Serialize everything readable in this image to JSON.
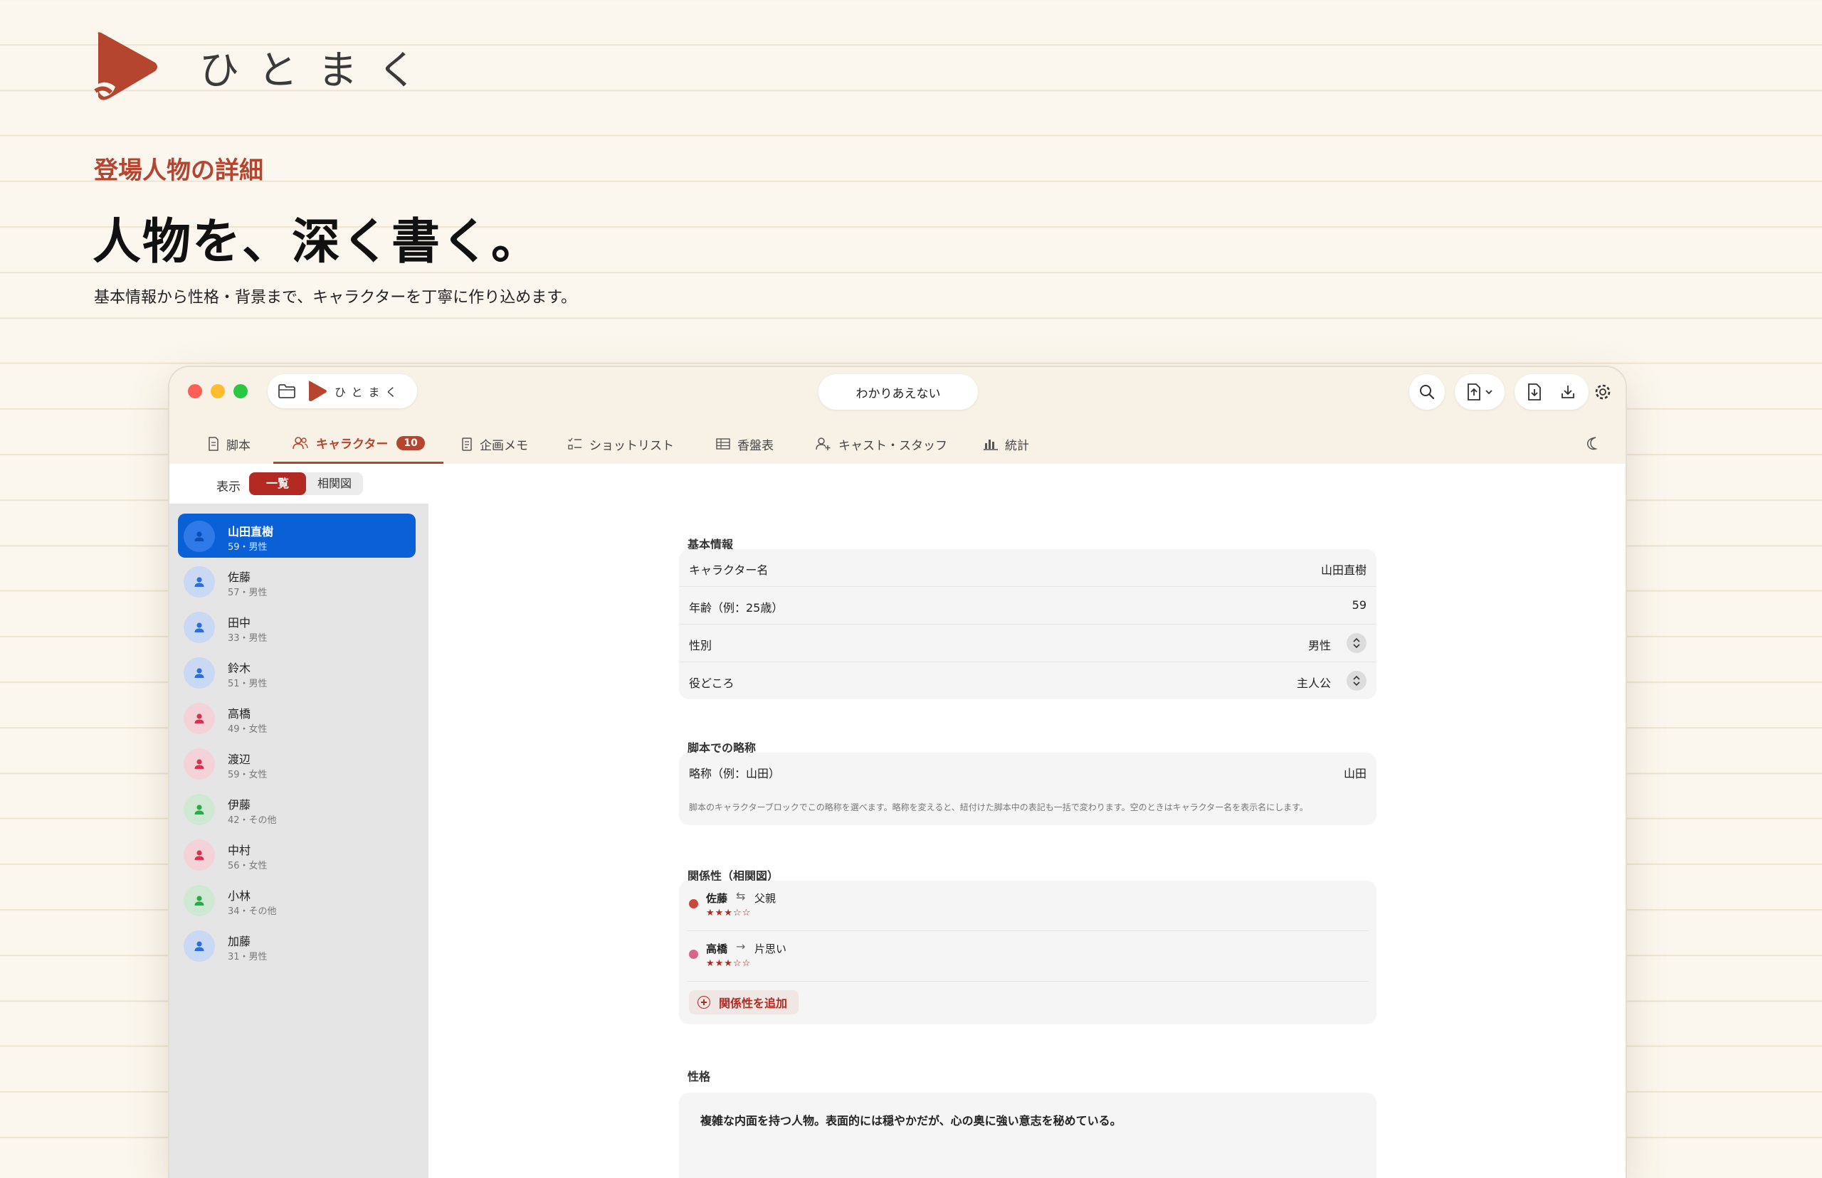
{
  "brand": {
    "name": "ひとまく",
    "color": "#b5452e"
  },
  "hero": {
    "eyebrow": "登場人物の詳細",
    "headline": "人物を、深く書く。",
    "lead": "基本情報から性格・背景まで、キャラクターを丁寧に作り込めます。"
  },
  "window": {
    "app_name": "ひとまく",
    "document_title": "わかりあえない",
    "tabs": [
      {
        "label": "脚本",
        "icon": "script-icon"
      },
      {
        "label": "キャラクター",
        "icon": "people-icon",
        "badge": "10",
        "active": true
      },
      {
        "label": "企画メモ",
        "icon": "memo-icon"
      },
      {
        "label": "ショットリスト",
        "icon": "checklist-icon"
      },
      {
        "label": "香盤表",
        "icon": "table-icon"
      },
      {
        "label": "キャスト・スタッフ",
        "icon": "person-add-icon"
      },
      {
        "label": "統計",
        "icon": "bar-chart-icon"
      }
    ],
    "view": {
      "label": "表示",
      "options": [
        "一覧",
        "相関図"
      ],
      "selected": "一覧"
    }
  },
  "characters": [
    {
      "name": "山田直樹",
      "meta": "59・男性",
      "gender": "male",
      "selected": true
    },
    {
      "name": "佐藤",
      "meta": "57・男性",
      "gender": "male"
    },
    {
      "name": "田中",
      "meta": "33・男性",
      "gender": "male"
    },
    {
      "name": "鈴木",
      "meta": "51・男性",
      "gender": "male"
    },
    {
      "name": "高橋",
      "meta": "49・女性",
      "gender": "female"
    },
    {
      "name": "渡辺",
      "meta": "59・女性",
      "gender": "female"
    },
    {
      "name": "伊藤",
      "meta": "42・その他",
      "gender": "other"
    },
    {
      "name": "中村",
      "meta": "56・女性",
      "gender": "female"
    },
    {
      "name": "小林",
      "meta": "34・その他",
      "gender": "other"
    },
    {
      "name": "加藤",
      "meta": "31・男性",
      "gender": "male"
    }
  ],
  "detail": {
    "basic": {
      "title": "基本情報",
      "name_label": "キャラクター名",
      "name_value": "山田直樹",
      "age_label": "年齢（例：25歳）",
      "age_value": "59",
      "gender_label": "性別",
      "gender_value": "男性",
      "role_label": "役どころ",
      "role_value": "主人公"
    },
    "abbrev": {
      "title": "脚本での略称",
      "label": "略称（例：山田）",
      "value": "山田",
      "note": "脚本のキャラクターブロックでこの略称を選べます。略称を変えると、紐付けた脚本中の表記も一括で変わります。空のときはキャラクター名を表示名にします。"
    },
    "relations": {
      "title": "関係性（相関図）",
      "items": [
        {
          "who": "佐藤",
          "arrow": "⇆",
          "kind": "父親",
          "stars": "★★★☆☆",
          "dot": "#c9483a"
        },
        {
          "who": "高橋",
          "arrow": "→",
          "kind": "片思い",
          "stars": "★★★☆☆",
          "dot": "#d9648c"
        }
      ],
      "add_label": "関係性を追加"
    },
    "personality": {
      "title": "性格",
      "text": "複雑な内面を持つ人物。表面的には穏やかだが、心の奥に強い意志を秘めている。"
    }
  }
}
